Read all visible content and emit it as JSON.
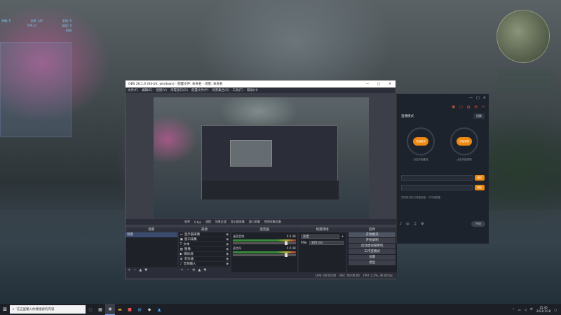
{
  "hud": {
    "rows": [
      {
        "left": "杀敌: 0",
        "mid": "击杀: 1/0",
        "right": "金钱: 0"
      },
      {
        "left": "",
        "mid": "FPS: 0",
        "right": "延迟: 0"
      },
      {
        "left": "",
        "mid": "",
        "right": "时间"
      }
    ]
  },
  "obs": {
    "title": "OBS 26.1.0 (64-bit, windows) - 配置文件: 未命名 - 场景: 未命名",
    "menu": [
      "文件(F)",
      "编辑(E)",
      "视图(V)",
      "停靠窗口(D)",
      "配置文件(P)",
      "场景集合(S)",
      "工具(T)",
      "帮助(H)"
    ],
    "status_strip": [
      "帧率",
      "0 fps",
      "滤镜",
      "场景过渡",
      "显示器采集",
      "窗口采集",
      "视频采集设备"
    ],
    "docks": {
      "scenes": {
        "title": "场景",
        "items": [
          "场景"
        ]
      },
      "sources": {
        "title": "来源",
        "items": [
          "显示器采集",
          "窗口采集",
          "文本",
          "图像",
          "媒体源",
          "浏览器",
          "音频输入",
          "色源"
        ]
      },
      "mixer": {
        "title": "混音器",
        "channels": [
          {
            "name": "桌面音频",
            "value": "0.0 dB"
          },
          {
            "name": "麦克风",
            "value": "0.0 dB"
          }
        ]
      },
      "transitions": {
        "title": "场景转场",
        "type_label": "淡出",
        "duration_label": "时长",
        "duration_value": "300 ms"
      },
      "controls": {
        "title": "控件",
        "buttons": [
          "开始推流",
          "开始录制",
          "启动虚拟摄像机",
          "工作室模式",
          "设置",
          "退出"
        ]
      }
    },
    "status": [
      "LIVE: 00:00:00",
      "REC: 00:00:00",
      "CPU: 2.3%, 30.00 fps"
    ]
  },
  "assistant": {
    "top_buttons": [
      "—",
      "□",
      "✕"
    ],
    "mode_label": "直播模式",
    "switch_label": "切换",
    "left_circle_label": "开始推流",
    "right_circle_label": "开始录制",
    "left_caption": "点击开始推流",
    "right_caption": "点击开始录制",
    "go_label": "确定",
    "confirm_label": "确定",
    "note": "您的推流码已准备就绪，可开始直播",
    "start_label": "开始"
  },
  "taskbar": {
    "search_placeholder": "在这里输入你要搜索的内容",
    "time": "15:40",
    "date": "2021/1/18"
  }
}
